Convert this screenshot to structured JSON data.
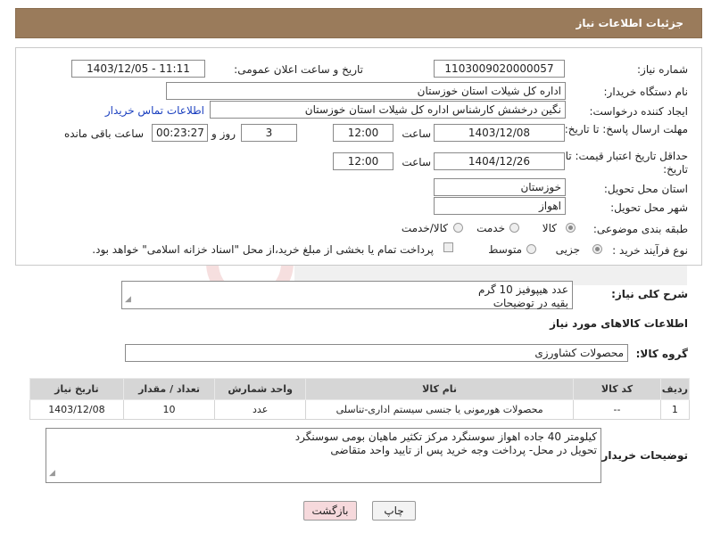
{
  "header": {
    "title": "جزئیات اطلاعات نیاز"
  },
  "form": {
    "need_number_label": "شماره نیاز:",
    "need_number": "1103009020000057",
    "announce_label": "تاریخ و ساعت اعلان عمومی:",
    "announce_value": "1403/12/05 - 11:11",
    "buyer_org_label": "نام دستگاه خریدار:",
    "buyer_org": "اداره کل شیلات استان خوزستان",
    "creator_label": "ایجاد کننده درخواست:",
    "creator": "نگین درخشش کارشناس اداره کل شیلات استان خوزستان",
    "contact_link": "اطلاعات تماس خریدار",
    "reply_deadline_label": "مهلت ارسال پاسخ: تا تاریخ:",
    "reply_date": "1403/12/08",
    "hour_label": "ساعت",
    "reply_time": "12:00",
    "days_value": "3",
    "days_label": "روز و",
    "remaining_time": "00:23:27",
    "remaining_label": "ساعت باقی مانده",
    "validity_label": "حداقل تاریخ اعتبار قیمت: تا تاریخ:",
    "validity_date": "1404/12/26",
    "validity_time": "12:00",
    "province_label": "استان محل تحویل:",
    "province": "خوزستان",
    "city_label": "شهر محل تحویل:",
    "city": "اهواز",
    "category_label": "طبقه بندی موضوعی:",
    "category_options": [
      "کالا",
      "خدمت",
      "کالا/خدمت"
    ],
    "process_label": "نوع فرآیند خرید :",
    "process_options": [
      "جزیی",
      "متوسط"
    ],
    "payment_note": "پرداخت تمام یا بخشی از مبلغ خرید،از محل \"اسناد خزانه اسلامی\" خواهد بود."
  },
  "description": {
    "label": "شرح کلی نیاز:",
    "text_line1": "عدد هیپوفیز 10 گرم",
    "text_line2": "بقیه در توضیحات"
  },
  "goods": {
    "section_title": "اطلاعات کالاهای مورد نیاز",
    "group_label": "گروه کالا:",
    "group_value": "محصولات کشاورزی"
  },
  "table": {
    "headers": [
      "ردیف",
      "کد کالا",
      "نام کالا",
      "واحد شمارش",
      "تعداد / مقدار",
      "تاریخ نیاز"
    ],
    "rows": [
      [
        "1",
        "--",
        "محصولات هورمونی یا جنسی سیستم اداری-تناسلی",
        "عدد",
        "10",
        "1403/12/08"
      ]
    ]
  },
  "buyer_notes": {
    "label": "توضیحات خریدار:",
    "line1": "کیلومتر 40 جاده اهواز سوسنگرد مرکز تکثیر ماهیان بومی سوسنگرد",
    "line2": "تحویل در محل- پرداخت وجه خرید پس از تایید واحد متقاضی"
  },
  "buttons": {
    "print": "چاپ",
    "back": "بازگشت"
  },
  "colors": {
    "header_bg": "#9a7b5b",
    "table_header_bg": "#d6d6d6",
    "back_btn_bg": "#f6d9dc",
    "link": "#1a3fbf"
  }
}
